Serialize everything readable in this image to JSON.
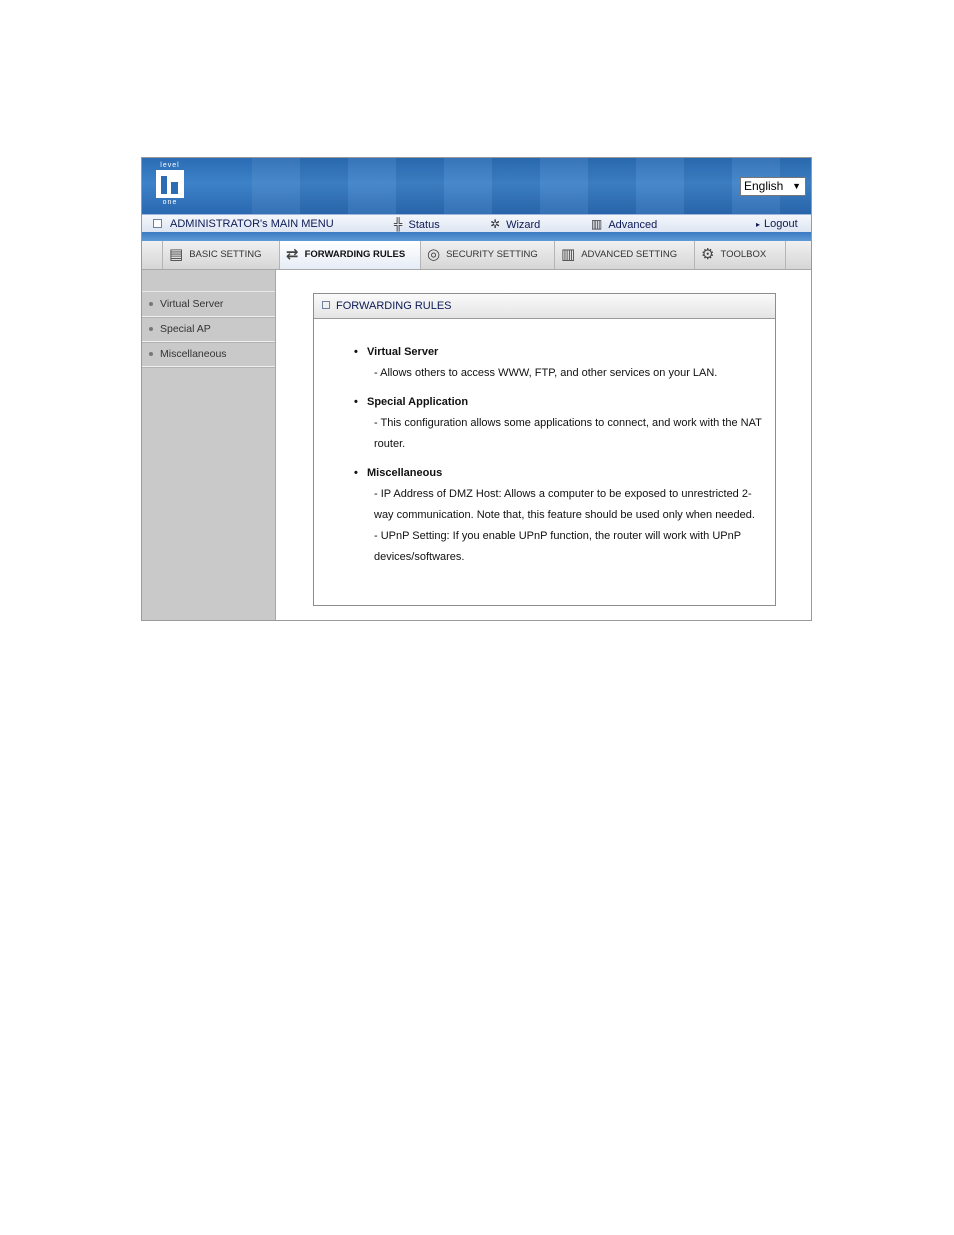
{
  "header": {
    "logo_top": "level",
    "logo_bottom": "one",
    "language": "English"
  },
  "menubar": {
    "title": "ADMINISTRATOR's MAIN MENU",
    "status": "Status",
    "wizard": "Wizard",
    "advanced": "Advanced",
    "logout": "Logout"
  },
  "tabs": [
    {
      "label": "BASIC SETTING"
    },
    {
      "label": "FORWARDING RULES"
    },
    {
      "label": "SECURITY SETTING"
    },
    {
      "label": "ADVANCED SETTING"
    },
    {
      "label": "TOOLBOX"
    }
  ],
  "sidebar": {
    "items": [
      {
        "label": "Virtual Server"
      },
      {
        "label": "Special AP"
      },
      {
        "label": "Miscellaneous"
      }
    ]
  },
  "panel": {
    "title": "FORWARDING RULES",
    "sections": [
      {
        "title": "Virtual Server",
        "desc": [
          "- Allows others to access WWW, FTP, and other services on your LAN."
        ]
      },
      {
        "title": "Special Application",
        "desc": [
          "- This configuration allows some applications to connect, and work with the NAT router."
        ]
      },
      {
        "title": "Miscellaneous",
        "desc": [
          "- IP Address of DMZ Host: Allows a computer to be exposed to unrestricted 2-way communication. Note that, this feature should be used only when needed.",
          "- UPnP Setting: If you enable UPnP function, the router will work with UPnP devices/softwares."
        ]
      }
    ]
  }
}
